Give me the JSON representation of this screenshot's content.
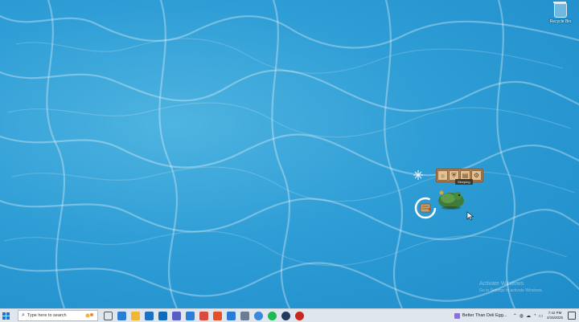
{
  "desktop": {
    "recycle_bin_label": "Recycle Bin",
    "watermark_title": "Activate Windows",
    "watermark_subtitle": "Go to Settings to activate Windows."
  },
  "pet_widget": {
    "toolbar_icons": [
      "bulb-icon",
      "shield-icon",
      "book-icon",
      "gear-icon"
    ],
    "toolbar_glyphs": [
      "☼",
      "⛨",
      "▤",
      "⚙"
    ],
    "status_label": "Sleeping",
    "colors": {
      "panel": "#b98a56",
      "pet": "#3f7b3a"
    }
  },
  "taskbar": {
    "search_placeholder": "Type here to search",
    "apps": [
      "task-view-icon",
      "edge-icon",
      "file-explorer-icon",
      "store-icon",
      "outlook-icon",
      "teams-icon",
      "photos-icon",
      "media-icon",
      "brave-icon",
      "vscode-icon",
      "app-icon",
      "chrome-icon",
      "spotify-icon",
      "steam-icon",
      "pet-app-icon"
    ],
    "app_colors": [
      "#555555",
      "#2b7cd3",
      "#f2b732",
      "#1f6fc2",
      "#0f6cbd",
      "#5a5fc8",
      "#2a80d8",
      "#d94b3d",
      "#e3512b",
      "#2a7bd8",
      "#6a7d92",
      "#3c87e0",
      "#1db954",
      "#23395d",
      "#c8281e"
    ],
    "notification_text": "Better Than Deli Egg...",
    "tray_icons": [
      "chevron-up-icon",
      "network-icon",
      "cloud-icon",
      "volume-icon",
      "keyboard-icon"
    ],
    "tray_glyphs": [
      "⌃",
      "◍",
      "☁",
      "◔",
      "▭"
    ],
    "time": "7:42 PM",
    "date": "4/15/2025"
  }
}
